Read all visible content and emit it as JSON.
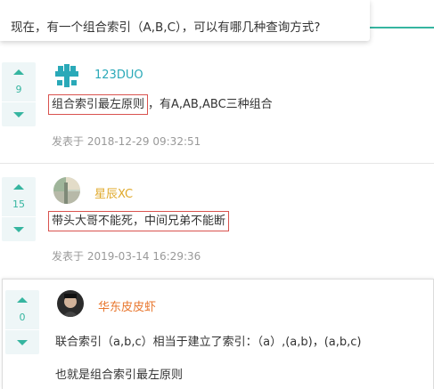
{
  "question": {
    "text": "现在，有一个组合索引（A,B,C），可以有哪几种查询方式?"
  },
  "answers": [
    {
      "votes": "9",
      "user": "123DUO",
      "user_color": "#2aa9b8",
      "line1_highlight": "组合索引最左原则",
      "line1_rest": "，有A,AB,ABC三种组合",
      "meta": "发表于 2018-12-29 09:32:51"
    },
    {
      "votes": "15",
      "user": "星辰XC",
      "user_color": "#e0a92a",
      "line1_highlight": "带头大哥不能死，中间兄弟不能断",
      "meta": "发表于 2019-03-14 16:29:36"
    },
    {
      "votes": "0",
      "user": "华东皮皮虾",
      "user_color": "#e8762d",
      "line1": "联合索引（a,b,c）相当于建立了索引：（a）,(a,b)，(a,b,c)",
      "line2": "也就是组合索引最左原则"
    }
  ],
  "colors": {
    "accent": "#36b5a0",
    "highlight_border": "#d9534f",
    "meta_text": "#999999"
  },
  "icons": {
    "vote_up": "triangle-up-icon",
    "vote_down": "triangle-down-icon"
  }
}
